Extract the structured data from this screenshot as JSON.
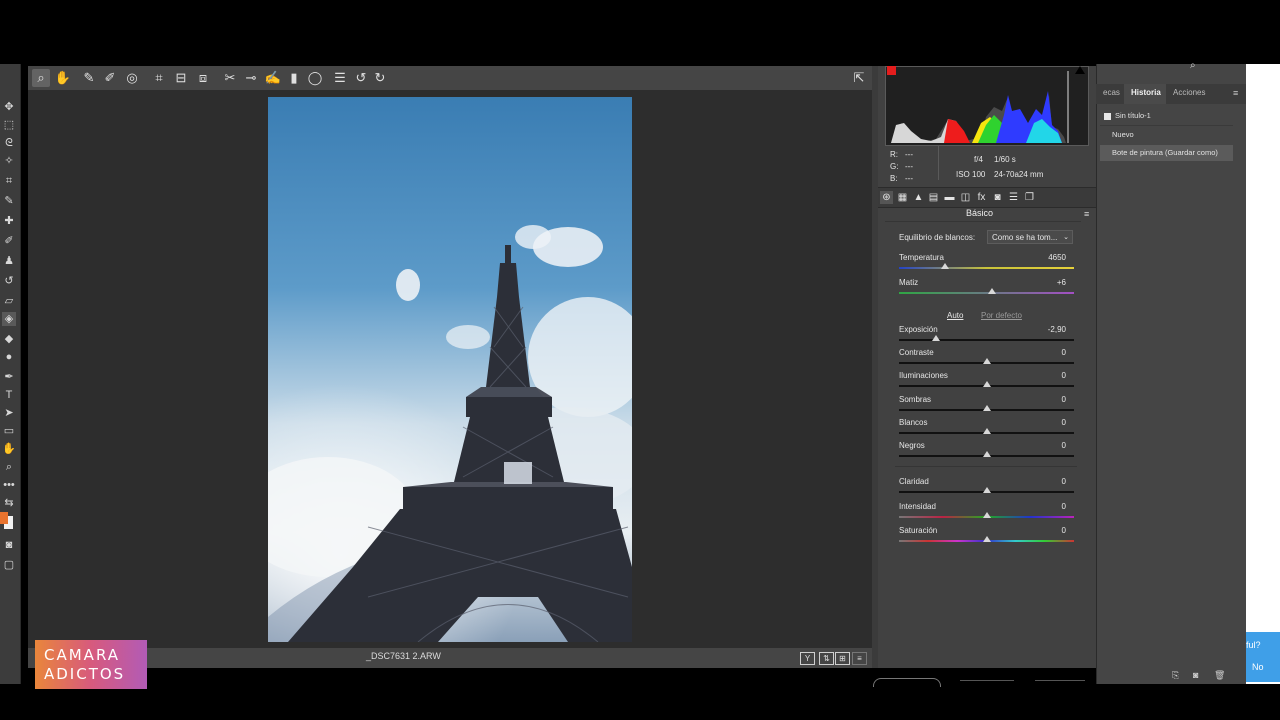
{
  "toolbar": {
    "tools": [
      "zoom-icon",
      "hand-icon",
      "white-balance-icon",
      "color-sampler-icon",
      "target-adjust-icon",
      "crop-icon",
      "straighten-icon",
      "transform-icon",
      "spot-removal-icon",
      "red-eye-icon",
      "adjustment-brush-icon",
      "graduated-filter-icon",
      "radial-filter-icon",
      "presets-list-icon",
      "rotate-left-icon",
      "rotate-right-icon"
    ]
  },
  "histogram": {
    "r_label": "R:",
    "r_value": "---",
    "g_label": "G:",
    "g_value": "---",
    "b_label": "B:",
    "b_value": "---",
    "aperture": "f/4",
    "shutter": "1/60 s",
    "iso": "ISO 100",
    "lens": "24-70a24 mm"
  },
  "panel": {
    "title": "Básico",
    "wb_label": "Equilibrio de blancos:",
    "wb_value": "Como se ha tom...",
    "auto": "Auto",
    "default": "Por defecto",
    "sliders": [
      {
        "label": "Temperatura",
        "value": "4650",
        "level": 0.26
      },
      {
        "label": "Matiz",
        "value": "+6",
        "level": 0.53
      },
      {
        "label": "Exposición",
        "value": "-2,90",
        "level": 0.21
      },
      {
        "label": "Contraste",
        "value": "0",
        "level": 0.5
      },
      {
        "label": "Iluminaciones",
        "value": "0",
        "level": 0.5
      },
      {
        "label": "Sombras",
        "value": "0",
        "level": 0.5
      },
      {
        "label": "Blancos",
        "value": "0",
        "level": 0.5
      },
      {
        "label": "Negros",
        "value": "0",
        "level": 0.5
      },
      {
        "label": "Claridad",
        "value": "0",
        "level": 0.5
      },
      {
        "label": "Intensidad",
        "value": "0",
        "level": 0.5
      },
      {
        "label": "Saturación",
        "value": "0",
        "level": 0.5
      }
    ]
  },
  "status": {
    "filename": "_DSC7631 2.ARW",
    "view_y": "Y"
  },
  "ps_panel": {
    "tab_partial": "ecas",
    "tab_history": "Historia",
    "tab_actions": "Acciones",
    "history": [
      "Sin título-1",
      "Nuevo",
      "Bote de pintura (Guardar como)"
    ]
  },
  "side": {
    "text1": "ful?",
    "text2": "No"
  },
  "logo": {
    "line1": "CAMARA",
    "line2": "ADICTOS"
  },
  "colors": {
    "accent_orange": "#e8732e",
    "sky_top": "#3a7db3",
    "logo_gradient": [
      "#e9863b",
      "#b25bb6"
    ]
  }
}
